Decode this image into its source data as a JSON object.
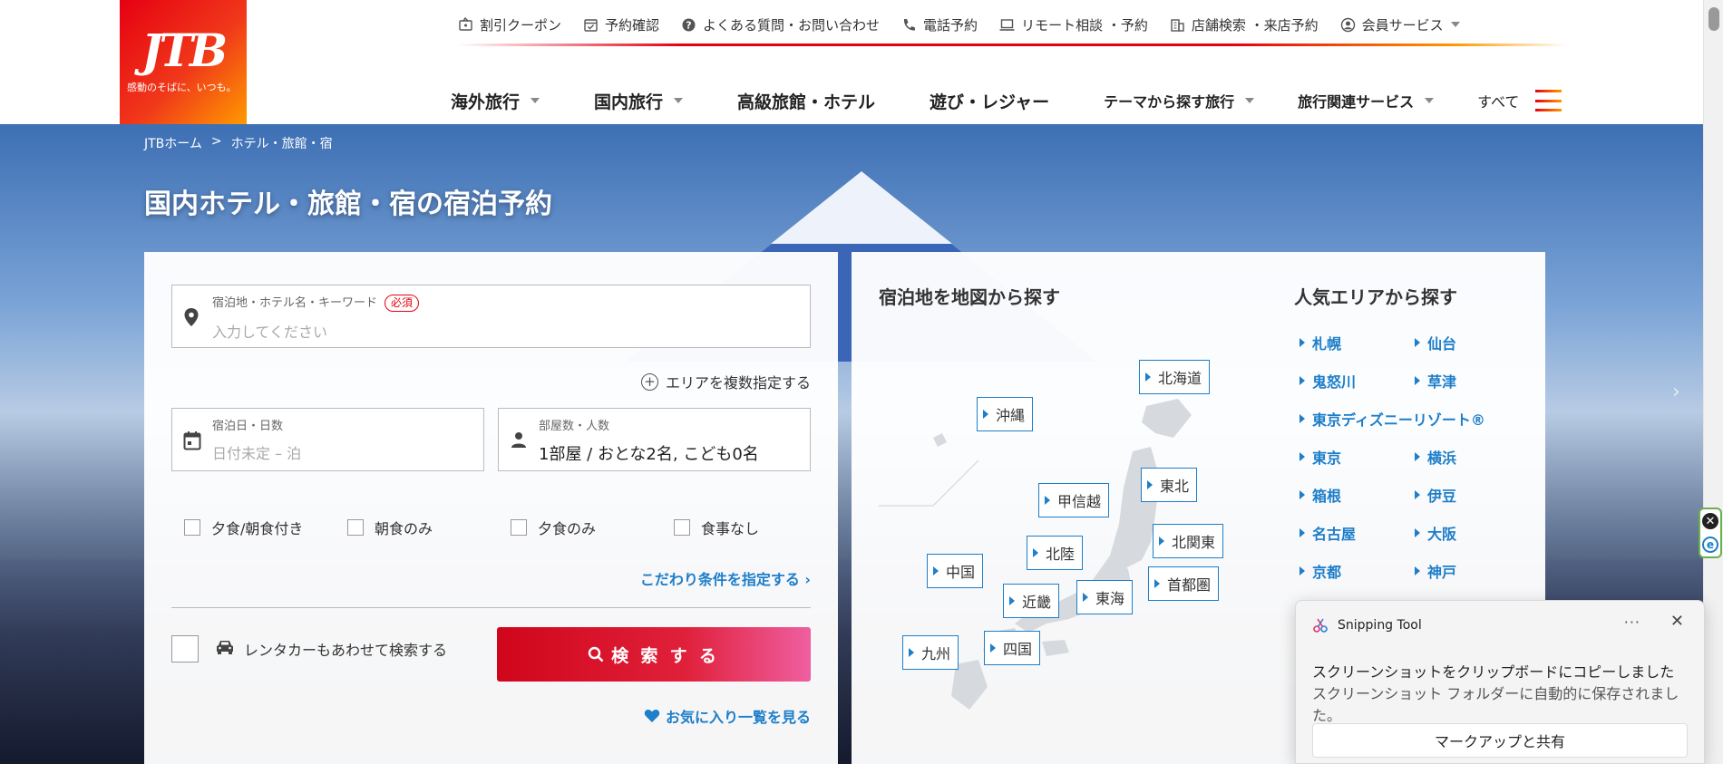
{
  "brand": {
    "logo_text": "JTB",
    "tagline": "感動のそばに、いつも。"
  },
  "utility_nav": [
    {
      "label": "割引クーポン",
      "icon": "coupon-icon"
    },
    {
      "label": "予約確認",
      "icon": "calendar-check-icon"
    },
    {
      "label": "よくある質問・お問い合わせ",
      "icon": "question-icon"
    },
    {
      "label": "電話予約",
      "icon": "phone-icon"
    },
    {
      "label": "リモート相談 ・予約",
      "icon": "laptop-icon"
    },
    {
      "label": "店舗検索 ・来店予約",
      "icon": "building-icon"
    },
    {
      "label": "会員サービス",
      "icon": "user-circle-icon"
    }
  ],
  "main_nav": {
    "items": [
      {
        "label": "海外旅行"
      },
      {
        "label": "国内旅行"
      },
      {
        "label": "高級旅館・ホテル"
      },
      {
        "label": "遊び・レジャー"
      },
      {
        "label": "テーマから探す旅行"
      },
      {
        "label": "旅行関連サービス"
      }
    ],
    "all_label": "すべて"
  },
  "breadcrumb": {
    "home": "JTBホーム",
    "separator": ">",
    "current": "ホテル・旅館・宿"
  },
  "hero": {
    "title": "国内ホテル・旅館・宿の宿泊予約"
  },
  "search": {
    "destination": {
      "label": "宿泊地・ホテル名・キーワード",
      "required": "必須",
      "placeholder": "入力してください"
    },
    "multi_area": "エリアを複数指定する",
    "dates": {
      "label": "宿泊日・日数",
      "placeholder": "日付未定 – 泊"
    },
    "rooms": {
      "label": "部屋数・人数",
      "value": "1部屋 / おとな2名, こども0名"
    },
    "meals": [
      "夕食/朝食付き",
      "朝食のみ",
      "夕食のみ",
      "食事なし"
    ],
    "more_conditions": "こだわり条件を指定する ›",
    "rental_car": "レンタカーもあわせて検索する",
    "search_button": "検 索 す る",
    "favorites": "お気に入り一覧を見る"
  },
  "map": {
    "title": "宿泊地を地図から探す",
    "regions": {
      "hokkaido": "北海道",
      "okinawa": "沖縄",
      "tohoku": "東北",
      "koshinetsu": "甲信越",
      "kitakanto": "北関東",
      "hokuriku": "北陸",
      "chugoku": "中国",
      "shutoken": "首都圏",
      "kinki": "近畿",
      "tokai": "東海",
      "kyushu": "九州",
      "shikoku": "四国"
    }
  },
  "popular": {
    "title": "人気エリアから探す",
    "areas": [
      "札幌",
      "仙台",
      "鬼怒川",
      "草津",
      "東京ディズニーリゾート®",
      "東京",
      "横浜",
      "箱根",
      "伊豆",
      "名古屋",
      "大阪",
      "京都",
      "神戸"
    ]
  },
  "toast": {
    "app_name": "Snipping Tool",
    "more": "···",
    "close": "✕",
    "message": "スクリーンショットをクリップボードにコピーしました",
    "sub_message": "スクリーンショット フォルダーに自動的に保存されました。",
    "action": "マークアップと共有"
  },
  "colors": {
    "brand_red": "#e60012",
    "brand_orange": "#ff9a00",
    "link_blue": "#1d7ec9"
  }
}
